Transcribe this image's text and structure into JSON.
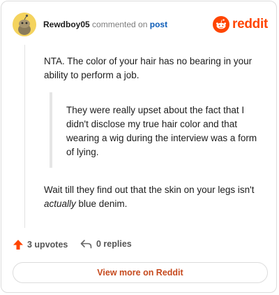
{
  "header": {
    "author": "Rewdboy05",
    "commented_text": "commented on",
    "post_link": "post",
    "brand": "reddit"
  },
  "comment": {
    "para1": "NTA. The color of your hair has no bearing in your ability to perform a job.",
    "quote": "They were really upset about the fact that I didn't disclose my true hair color and that wearing a wig during the interview was a form of lying.",
    "para2_before": "Wait till they find out that the skin on your legs isn't ",
    "para2_emphasis": "actually",
    "para2_after": " blue denim."
  },
  "footer": {
    "upvotes": "3 upvotes",
    "replies": "0 replies",
    "view_more": "View more on Reddit"
  },
  "colors": {
    "brand_orange": "#ff4500",
    "upvote_orange": "#ff4500",
    "link_blue": "#0a5bb8"
  }
}
